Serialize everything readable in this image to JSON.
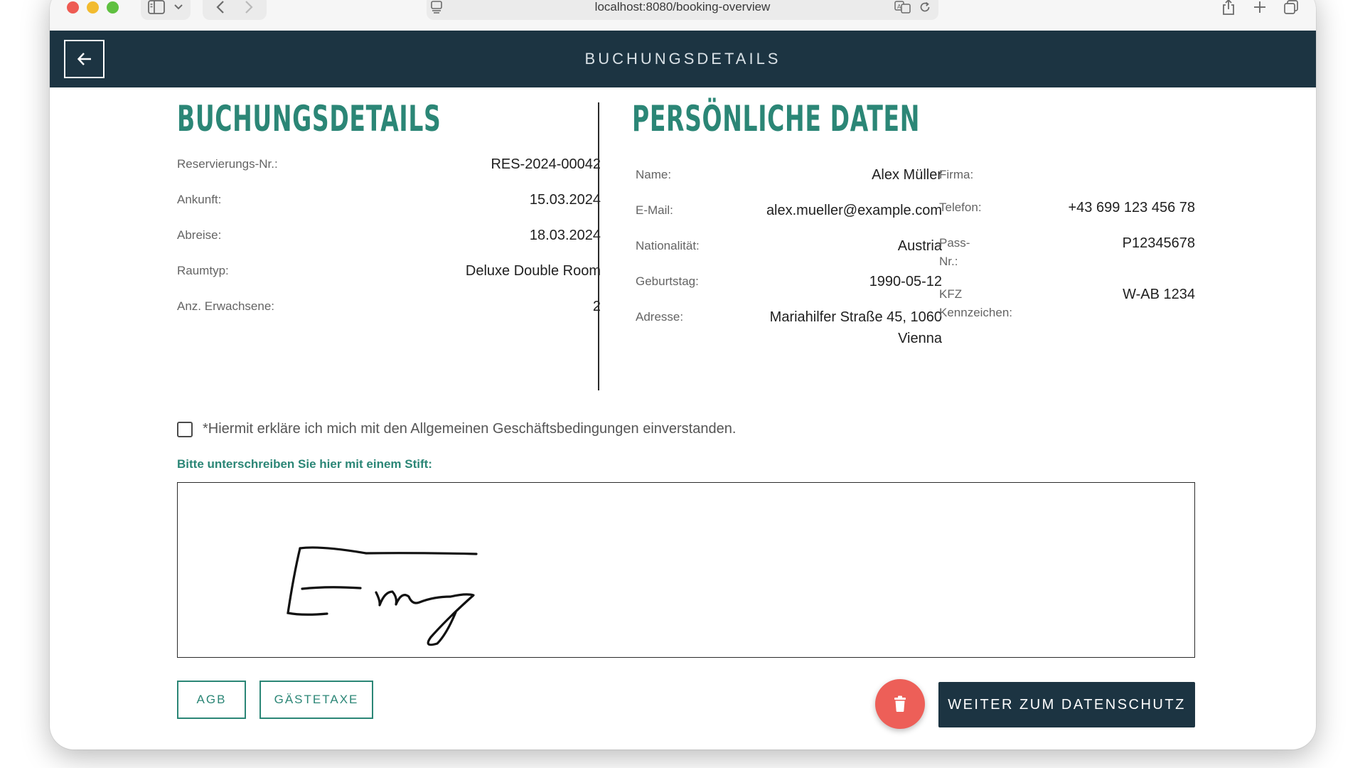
{
  "browser": {
    "url": "localhost:8080/booking-overview"
  },
  "header": {
    "title": "BUCHUNGSDETAILS"
  },
  "booking": {
    "heading": "BUCHUNGSDETAILS",
    "fields": [
      {
        "label": "Reservierungs-Nr.:",
        "value": "RES-2024-00042"
      },
      {
        "label": "Ankunft:",
        "value": "15.03.2024"
      },
      {
        "label": "Abreise:",
        "value": "18.03.2024"
      },
      {
        "label": "Raumtyp:",
        "value": "Deluxe Double Room"
      },
      {
        "label": "Anz. Erwachsene:",
        "value": "2"
      }
    ]
  },
  "personal": {
    "heading": "PERSÖNLICHE DATEN",
    "left": [
      {
        "label": "Name:",
        "value": "Alex Müller"
      },
      {
        "label": "E-Mail:",
        "value": "alex.mueller@example.com"
      },
      {
        "label": "Nationalität:",
        "value": "Austria"
      },
      {
        "label": "Geburtstag:",
        "value": "1990-05-12"
      },
      {
        "label": "Adresse:",
        "value_line1": "Mariahilfer Straße 45, 1060",
        "value_line2": "Vienna"
      }
    ],
    "right": [
      {
        "label": "Firma:",
        "value": ""
      },
      {
        "label": "Telefon:",
        "value": "+43 699 123 456 78"
      },
      {
        "label_line1": "Pass-",
        "label_line2": "Nr.:",
        "value": "P12345678"
      },
      {
        "label_line1": "KFZ",
        "label_line2": "Kennzeichen:",
        "value": "W-AB 1234"
      }
    ]
  },
  "terms": {
    "text": "*Hiermit erkläre ich mich mit den Allgemeinen Geschäftsbedingungen einverstanden.",
    "checked": false
  },
  "signature": {
    "label": "Bitte unterschreiben Sie hier mit einem Stift:"
  },
  "actions": {
    "agb": "AGB",
    "guest_tax": "GÄSTETAXE",
    "continue": "WEITER ZUM DATENSCHUTZ"
  },
  "colors": {
    "header_bg": "#1c3442",
    "accent": "#2b8676",
    "danger": "#ed5f58"
  }
}
